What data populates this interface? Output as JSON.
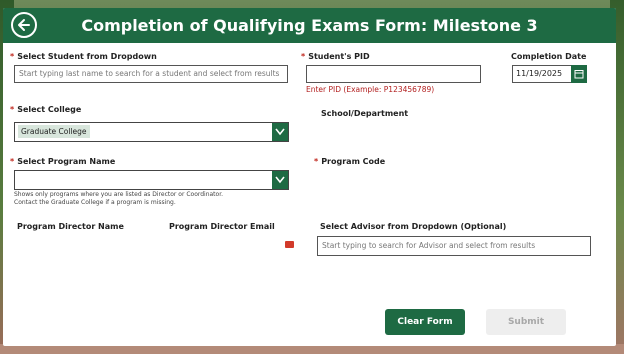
{
  "header": {
    "title": "Completion of Qualifying Exams Form: Milestone 3"
  },
  "form": {
    "required_mark": "*",
    "student": {
      "label": "Select Student from Dropdown",
      "placeholder": "Start typing last name to search for a student and select from results"
    },
    "pid": {
      "label": "Student's PID",
      "value": "",
      "error": "Enter PID (Example: P123456789)"
    },
    "completion_date": {
      "label": "Completion Date",
      "value": "11/19/2025"
    },
    "college": {
      "label": "Select College",
      "value": "Graduate College"
    },
    "school_department": {
      "label": "School/Department"
    },
    "program_name": {
      "label": "Select Program Name",
      "value": "",
      "help_line1": "Shows only programs where you are listed as Director or Coordinator.",
      "help_line2": "Contact the Graduate College if a program is missing."
    },
    "program_code": {
      "label": "Program Code"
    },
    "program_director_name": {
      "label": "Program Director Name"
    },
    "program_director_email": {
      "label": "Program Director Email"
    },
    "advisor": {
      "label": "Select Advisor from Dropdown (Optional)",
      "placeholder": "Start typing to search for Advisor and select from results"
    }
  },
  "actions": {
    "clear_label": "Clear Form",
    "submit_label": "Submit"
  },
  "colors": {
    "brand_green": "#1e6a43",
    "error_red": "#b21f1f"
  }
}
